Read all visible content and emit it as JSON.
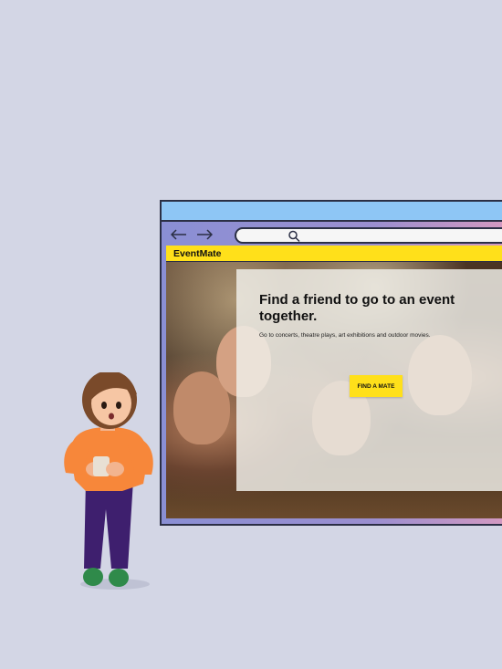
{
  "site": {
    "logo": "EventMate",
    "headline": "Find a friend to go to an event together.",
    "subline": "Go to concerts, theatre plays, art exhibitions and outdoor movies.",
    "cta_label": "FIND A MATE"
  },
  "colors": {
    "background": "#d3d6e5",
    "titlebar": "#8ec6f5",
    "accent_yellow": "#ffe01a",
    "outline": "#2b2f45"
  },
  "icons": [
    "back-arrow-icon",
    "forward-arrow-icon",
    "search-icon"
  ]
}
